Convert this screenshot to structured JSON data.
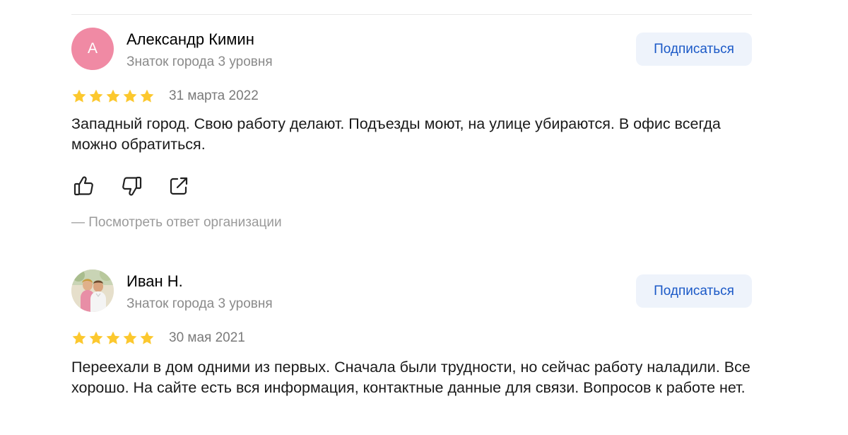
{
  "reviews": [
    {
      "avatar_letter": "А",
      "author": "Александр Кимин",
      "level": "Знаток города 3 уровня",
      "subscribe_label": "Подписаться",
      "rating": 5,
      "date": "31 марта 2022",
      "text": "Западный город. Свою работу делают. Подъезды моют, на улице убираются. В офис всегда можно обратиться.",
      "actions": [
        "like-icon",
        "dislike-icon",
        "share-icon"
      ],
      "org_reply_label": "— Посмотреть ответ организации"
    },
    {
      "avatar_letter": "",
      "author": "Иван Н.",
      "level": "Знаток города 3 уровня",
      "subscribe_label": "Подписаться",
      "rating": 5,
      "date": "30 мая 2021",
      "text": "Переехали в дом одними из первых. Сначала были трудности, но сейчас работу наладили. Все хорошо. На сайте есть вся информация, контактные данные для связи. Вопросов к работе нет."
    }
  ],
  "colors": {
    "star": "#fcc82e",
    "avatar_bg": "#f08aa4",
    "subscribe_bg": "#eef3fb",
    "subscribe_text": "#1b59c7",
    "secondary_text": "#8a8a8a"
  }
}
